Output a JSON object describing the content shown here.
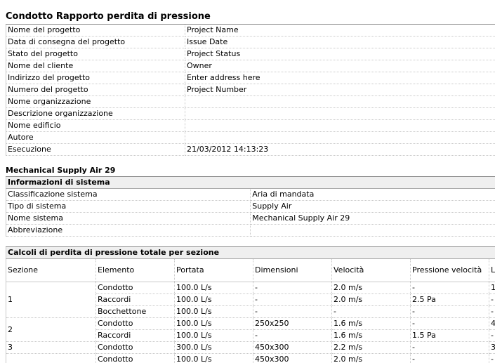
{
  "title": "Condotto Rapporto perdita di pressione",
  "project": [
    {
      "label": "Nome del progetto",
      "value": "Project Name"
    },
    {
      "label": "Data di consegna del progetto",
      "value": "Issue Date"
    },
    {
      "label": "Stato del progetto",
      "value": "Project Status"
    },
    {
      "label": "Nome del cliente",
      "value": "Owner"
    },
    {
      "label": "Indirizzo del progetto",
      "value": "Enter address here"
    },
    {
      "label": "Numero del progetto",
      "value": "Project Number"
    },
    {
      "label": "Nome organizzazione",
      "value": ""
    },
    {
      "label": "Descrizione organizzazione",
      "value": ""
    },
    {
      "label": "Nome edificio",
      "value": ""
    },
    {
      "label": "Autore",
      "value": ""
    },
    {
      "label": "Esecuzione",
      "value": "21/03/2012 14:13:23"
    }
  ],
  "system_title": "Mechanical Supply Air 29",
  "system_info": {
    "header": "Informazioni di sistema",
    "rows": [
      {
        "label": "Classificazione sistema",
        "value": "Aria di mandata"
      },
      {
        "label": "Tipo di sistema",
        "value": "Supply Air"
      },
      {
        "label": "Nome sistema",
        "value": "Mechanical Supply Air 29"
      },
      {
        "label": "Abbreviazione",
        "value": ""
      }
    ]
  },
  "loss": {
    "header": "Calcoli di perdita di pressione totale per sezione",
    "columns": [
      "Sezione",
      "Elemento",
      "Portata",
      "Dimensioni",
      "Velocità",
      "Pressione velocità",
      "L"
    ],
    "rows": [
      {
        "section": "1",
        "rowspan": 3,
        "items": [
          [
            "Condotto",
            "100.0 L/s",
            "-",
            "2.0 m/s",
            "-",
            "1"
          ],
          [
            "Raccordi",
            "100.0 L/s",
            "-",
            "2.0 m/s",
            "2.5 Pa",
            "-"
          ],
          [
            "Bocchettone",
            "100.0 L/s",
            "-",
            "-",
            "-",
            "-"
          ]
        ]
      },
      {
        "section": "2",
        "rowspan": 2,
        "items": [
          [
            "Condotto",
            "100.0 L/s",
            "250x250",
            "1.6 m/s",
            "-",
            "4"
          ],
          [
            "Raccordi",
            "100.0 L/s",
            "-",
            "1.6 m/s",
            "1.5 Pa",
            "-"
          ]
        ]
      },
      {
        "section": "3",
        "rowspan": 1,
        "items": [
          [
            "Condotto",
            "300.0 L/s",
            "450x300",
            "2.2 m/s",
            "-",
            "3"
          ]
        ]
      },
      {
        "section": "",
        "rowspan": 1,
        "items": [
          [
            "Condotto",
            "100.0 L/s",
            "450x300",
            "2.0 m/s",
            "-",
            "-"
          ]
        ]
      }
    ]
  }
}
